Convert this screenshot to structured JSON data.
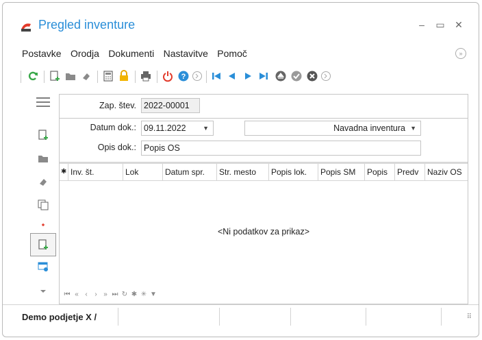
{
  "window": {
    "title": "Pregled inventure",
    "minimize_glyph": "–",
    "maximize_glyph": "▭",
    "close_glyph": "✕"
  },
  "menu": [
    {
      "label": "Postavke"
    },
    {
      "label": "Orodja"
    },
    {
      "label": "Dokumenti"
    },
    {
      "label": "Nastavitve"
    },
    {
      "label": "Pomoč"
    }
  ],
  "form": {
    "zap_stev_label": "Zap. štev.",
    "zap_stev_value": "2022-00001",
    "datum_label": "Datum dok.:",
    "datum_value": "09.11.2022",
    "type_value": "Navadna inventura",
    "opis_label": "Opis dok.:",
    "opis_value": "Popis OS"
  },
  "grid": {
    "columns": [
      "Inv. št.",
      "Lok",
      "Datum spr.",
      "Str. mesto",
      "Popis lok.",
      "Popis SM",
      "Popis",
      "Predv",
      "Naziv OS"
    ],
    "empty_text": "<Ni podatkov za prikaz>"
  },
  "status": {
    "text": "Demo podjetje X /"
  },
  "colors": {
    "accent": "#2a8ed8",
    "red": "#e23a2a",
    "green": "#3aa84a"
  }
}
